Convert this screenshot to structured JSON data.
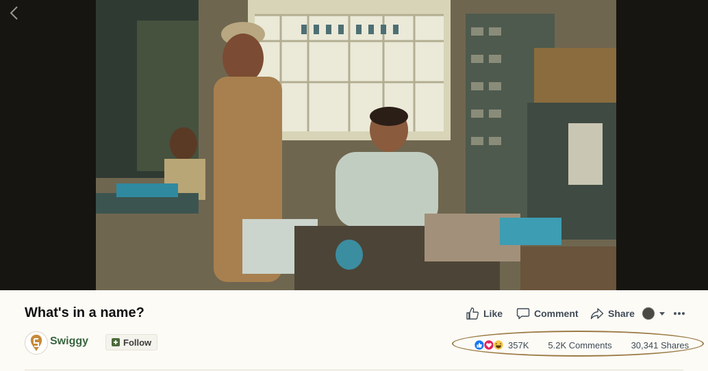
{
  "post": {
    "title": "What's in a name?",
    "page_name": "Swiggy",
    "follow_label": "Follow"
  },
  "actions": {
    "like_label": "Like",
    "comment_label": "Comment",
    "share_label": "Share"
  },
  "stats": {
    "reactions_count": "357K",
    "comments": "5.2K Comments",
    "shares": "30,341 Shares",
    "reaction_icons": [
      "like-reaction-icon",
      "love-reaction-icon",
      "haha-reaction-icon"
    ]
  },
  "colors": {
    "page_name": "#38653f",
    "like_blue": "#1877f2",
    "love_red": "#e0245e",
    "highlight_ring": "#9c7b45"
  }
}
